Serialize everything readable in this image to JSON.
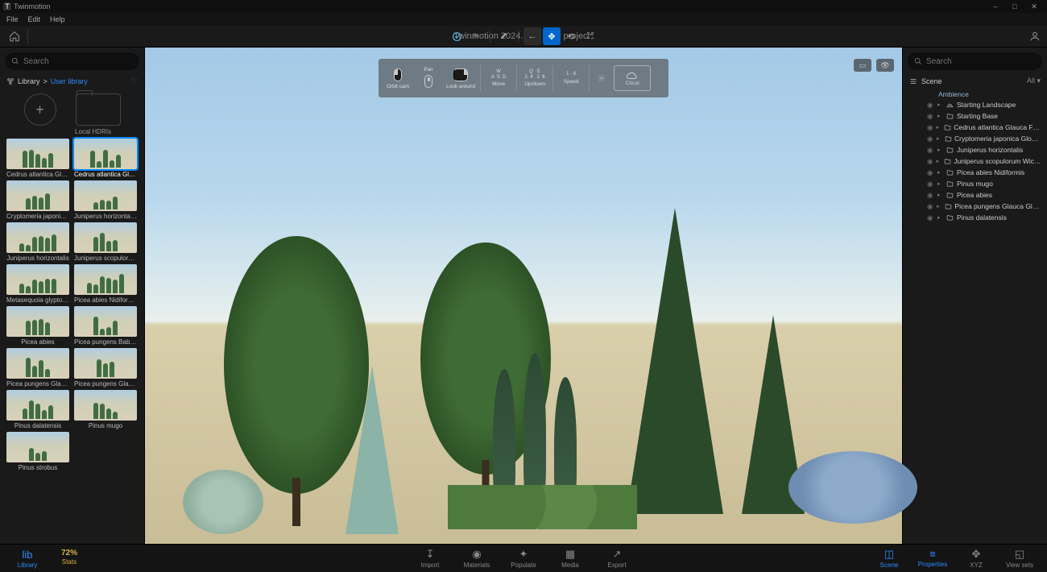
{
  "app": {
    "brand": "Twinmotion",
    "title": "Twinmotion 2024.1.2 - New project*"
  },
  "menu": [
    "File",
    "Edit",
    "Help"
  ],
  "window_controls": [
    "–",
    "□",
    "✕"
  ],
  "left": {
    "search_placeholder": "Search",
    "breadcrumb": {
      "root": "Library",
      "sep": ">",
      "current": "User library"
    },
    "create_tiles": {
      "add": "",
      "folder": "Local HDRIs"
    },
    "thumbs": [
      {
        "label": "Cedrus atlantica Glauc…",
        "selected": false
      },
      {
        "label": "Cedrus atlantica Glauc…",
        "selected": true
      },
      {
        "label": "Cryptomeria japonica…",
        "selected": false
      },
      {
        "label": "Juniperus horizontalis…",
        "selected": false
      },
      {
        "label": "Juniperus horizontalis",
        "selected": false
      },
      {
        "label": "Juniperus scopulorum…",
        "selected": false
      },
      {
        "label": "Metasequoia glyptostro…",
        "selected": false
      },
      {
        "label": "Picea abies Nidiformis",
        "selected": false
      },
      {
        "label": "Picea abies",
        "selected": false
      },
      {
        "label": "Picea pungens Baby Bl…",
        "selected": false
      },
      {
        "label": "Picea pungens Glauca…",
        "selected": false
      },
      {
        "label": "Picea pungens Glauca…",
        "selected": false
      },
      {
        "label": "Pinus dalatensis",
        "selected": false
      },
      {
        "label": "Pinus mugo",
        "selected": false
      },
      {
        "label": "Pinus strobus",
        "selected": false
      }
    ]
  },
  "overlay": {
    "pan": "Pan",
    "orbit": "Orbit cam",
    "look": "Look around",
    "move": "Move",
    "move_keys": "W\nA  S  D",
    "gear": "",
    "gear_keys": "Q   E\n2  4   2  6",
    "updown": "Up/down",
    "speed": "Speed",
    "speed_keys": "1 - 6",
    "cloud": "Cloud"
  },
  "right": {
    "search_placeholder": "Search",
    "scene_label": "Scene",
    "all_label": "All",
    "nodes": [
      {
        "label": "Ambience",
        "level": 1,
        "icon": "ambience",
        "class": "ambience"
      },
      {
        "label": "Starting Landscape",
        "level": 2,
        "icon": "terrain"
      },
      {
        "label": "Starting Base",
        "level": 2,
        "icon": "folder"
      },
      {
        "label": "Cedrus atlantica Glauca Fastigiata",
        "level": 2,
        "icon": "folder"
      },
      {
        "label": "Cryptomeria japonica Globosa…",
        "level": 2,
        "icon": "folder"
      },
      {
        "label": "Juniperus horizontalis",
        "level": 2,
        "icon": "folder"
      },
      {
        "label": "Juniperus scopulorum Wichita B…",
        "level": 2,
        "icon": "folder"
      },
      {
        "label": "Picea abies Nidiformis",
        "level": 2,
        "icon": "folder"
      },
      {
        "label": "Pinus mugo",
        "level": 2,
        "icon": "folder"
      },
      {
        "label": "Picea abies",
        "level": 2,
        "icon": "folder"
      },
      {
        "label": "Picea pungens Glauca Globosa",
        "level": 2,
        "icon": "folder"
      },
      {
        "label": "Pinus dalatensis",
        "level": 2,
        "icon": "folder"
      }
    ]
  },
  "footer": {
    "left": [
      {
        "label": "Library",
        "icon": "lib",
        "active": true
      },
      {
        "label": "Stats",
        "icon": "72%",
        "stats": true
      }
    ],
    "center": [
      {
        "label": "Import",
        "icon": "↧"
      },
      {
        "label": "Materials",
        "icon": "◉"
      },
      {
        "label": "Populate",
        "icon": "✦"
      },
      {
        "label": "Media",
        "icon": "▦"
      },
      {
        "label": "Export",
        "icon": "↗"
      }
    ],
    "right": [
      {
        "label": "Scene",
        "icon": "◫",
        "active": true
      },
      {
        "label": "Properties",
        "icon": "≡",
        "active": true
      },
      {
        "label": "XYZ",
        "icon": "✥"
      },
      {
        "label": "View sets",
        "icon": "◱"
      }
    ],
    "stats_value": "72%"
  }
}
